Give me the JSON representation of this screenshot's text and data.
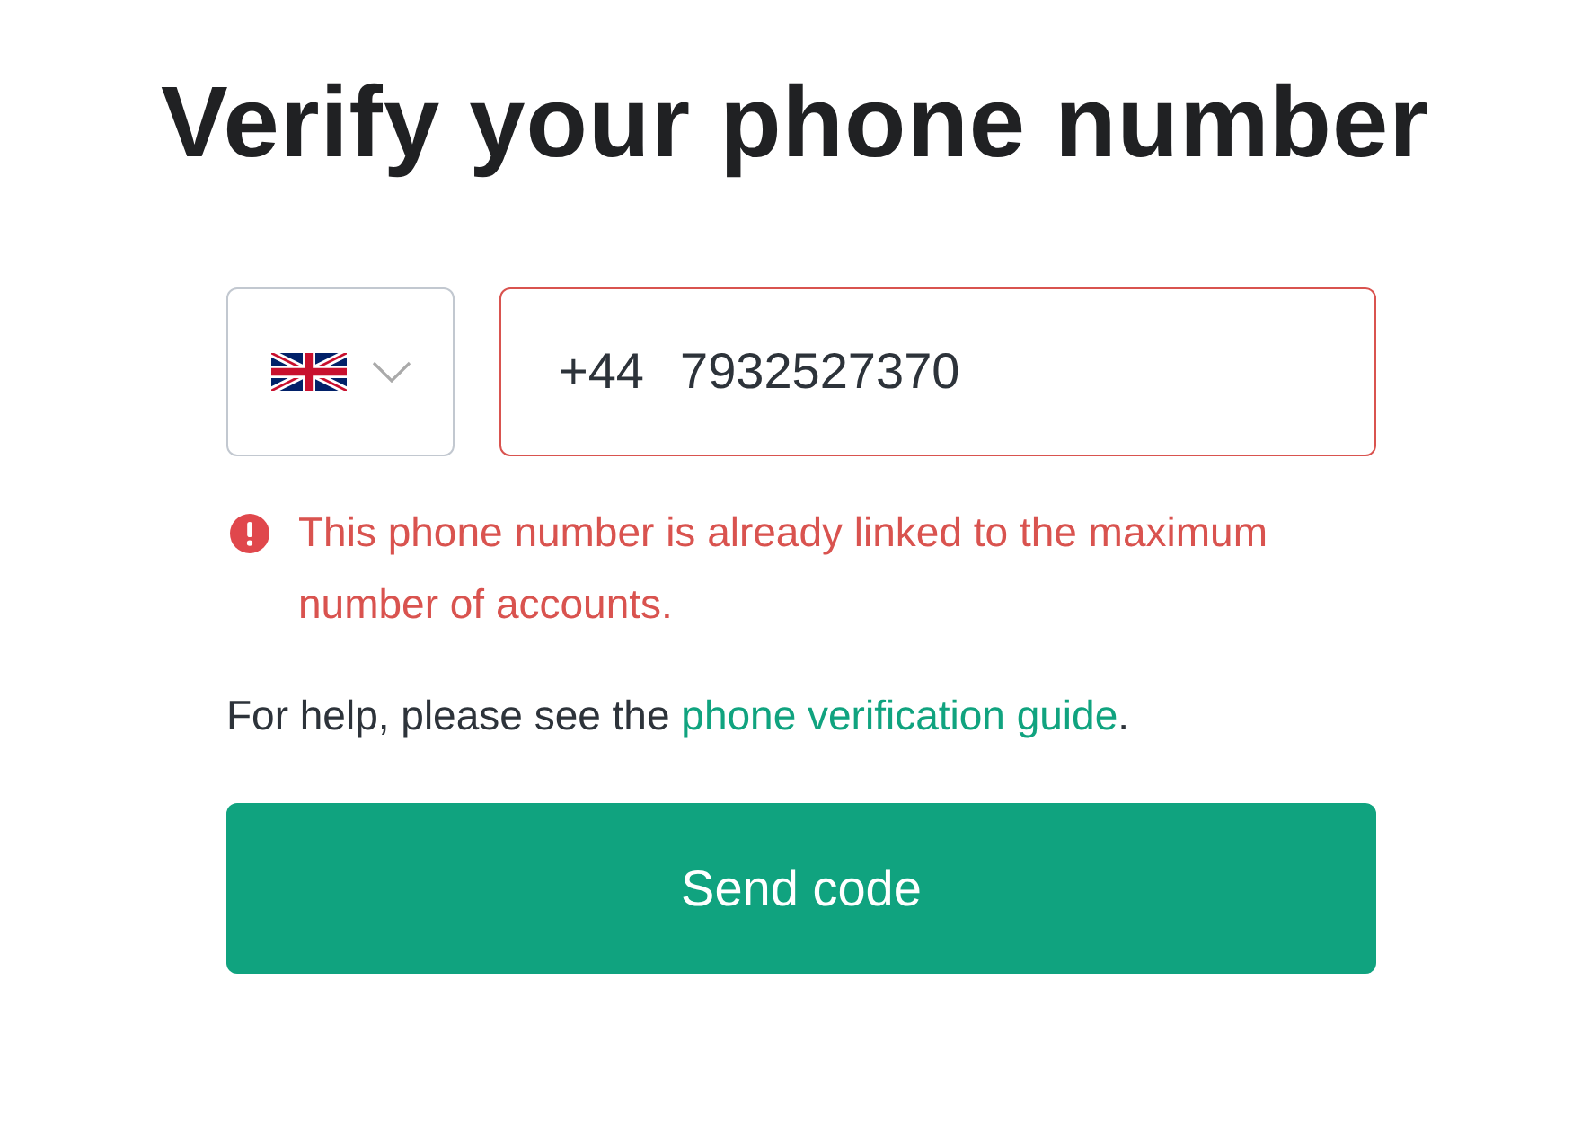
{
  "title": "Verify your phone number",
  "phone": {
    "prefix": "+44",
    "value": "7932527370",
    "invalid": true
  },
  "error": "This phone number is already linked to the maximum number of accounts.",
  "help": {
    "text_before": "For help, please see the ",
    "link": "phone verification guide",
    "text_after": "."
  },
  "button": "Send code"
}
